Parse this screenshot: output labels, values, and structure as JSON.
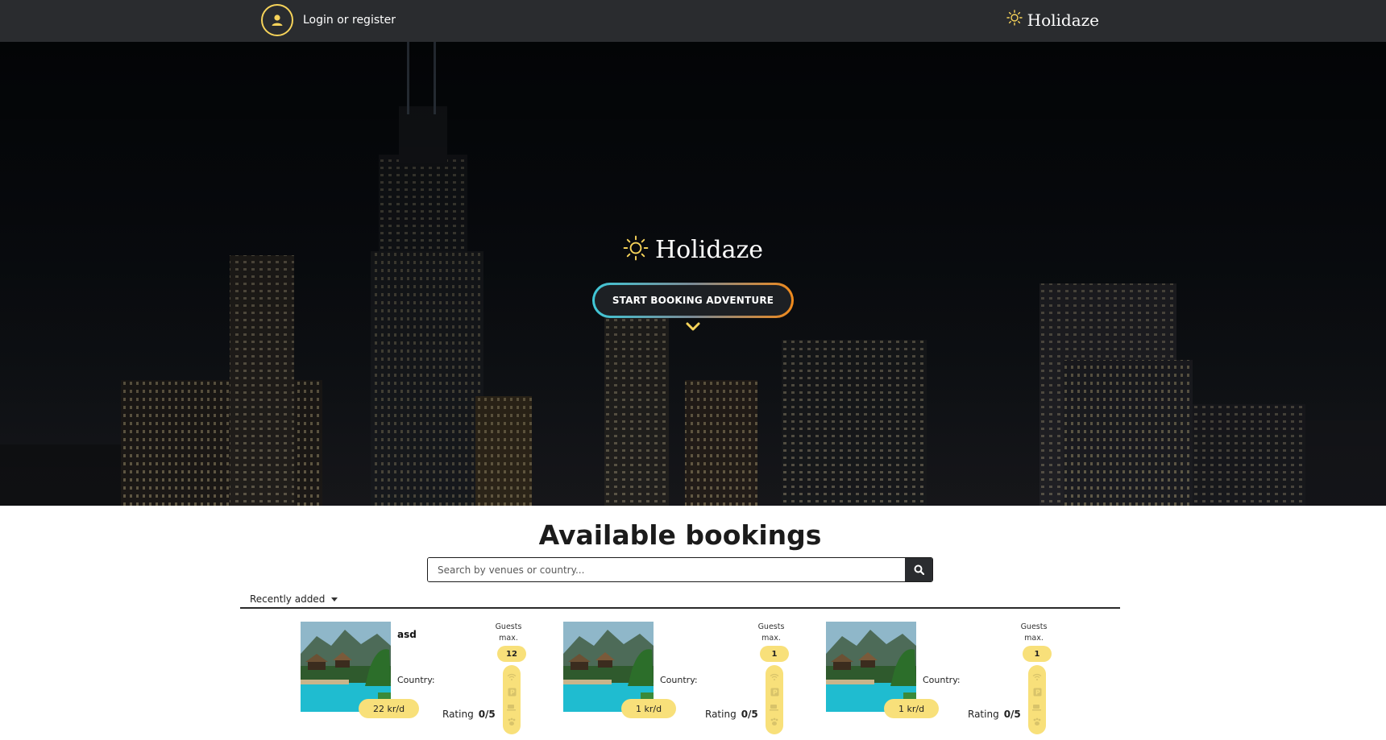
{
  "nav": {
    "login_label": "Login or register",
    "brand": "Holidaze"
  },
  "hero": {
    "brand": "Holidaze",
    "cta_label": "START BOOKING ADVENTURE"
  },
  "listing": {
    "title": "Available bookings",
    "search_placeholder": "Search by venues or country...",
    "sort_label": "Recently added",
    "country_label": "Country:",
    "rating_label": "Rating",
    "guests_label_1": "Guests",
    "guests_label_2": "max.",
    "cards": [
      {
        "name": "asd",
        "price": "22 kr/d",
        "guests": "12",
        "rating": "0/5"
      },
      {
        "name": "",
        "price": "1 kr/d",
        "guests": "1",
        "rating": "0/5"
      },
      {
        "name": "",
        "price": "1 kr/d",
        "guests": "1",
        "rating": "0/5"
      }
    ]
  },
  "colors": {
    "nav_bg": "#2a2c2f",
    "accent_yellow": "#f6d35a",
    "badge_yellow": "#f8e07a",
    "cta_gradient_start": "#3fc8d8",
    "cta_gradient_end": "#f08a1c"
  },
  "icons": [
    "user-icon",
    "sun-icon",
    "chevron-down-icon",
    "search-icon",
    "caret-down-icon",
    "wifi-icon",
    "parking-icon",
    "breakfast-icon",
    "pets-icon"
  ]
}
